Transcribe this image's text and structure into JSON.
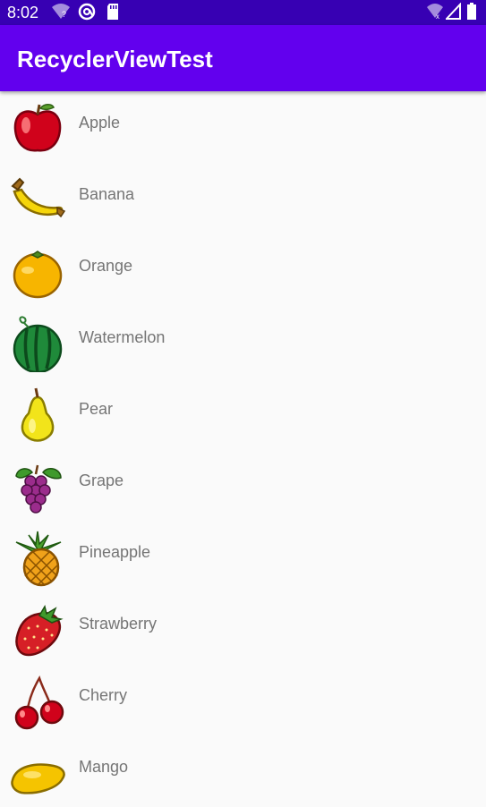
{
  "status_bar": {
    "time": "8:02",
    "icons": [
      "wifi-question-icon",
      "at-sign-icon",
      "sd-card-icon",
      "wifi-off-icon",
      "signal-icon",
      "battery-icon"
    ]
  },
  "app_bar": {
    "title": "RecyclerViewTest"
  },
  "fruits": [
    {
      "name": "Apple",
      "icon": "apple-icon"
    },
    {
      "name": "Banana",
      "icon": "banana-icon"
    },
    {
      "name": "Orange",
      "icon": "orange-icon"
    },
    {
      "name": "Watermelon",
      "icon": "watermelon-icon"
    },
    {
      "name": "Pear",
      "icon": "pear-icon"
    },
    {
      "name": "Grape",
      "icon": "grape-icon"
    },
    {
      "name": "Pineapple",
      "icon": "pineapple-icon"
    },
    {
      "name": "Strawberry",
      "icon": "strawberry-icon"
    },
    {
      "name": "Cherry",
      "icon": "cherry-icon"
    },
    {
      "name": "Mango",
      "icon": "mango-icon"
    }
  ],
  "colors": {
    "status_bar": "#3700b3",
    "app_bar": "#6200ee",
    "background": "#fafafa",
    "item_text": "#757575"
  }
}
